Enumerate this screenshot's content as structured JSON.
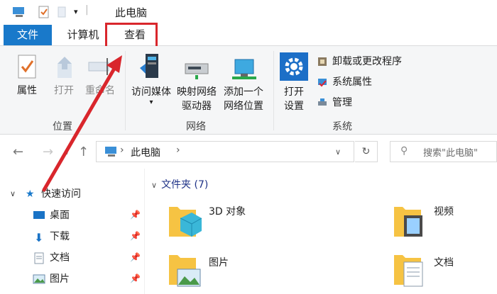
{
  "title": "此电脑",
  "tabs": {
    "file": "文件",
    "computer": "计算机",
    "view": "查看"
  },
  "ribbon": {
    "location": {
      "label": "位置",
      "buttons": [
        {
          "label": "属性",
          "icon": "properties-check-icon"
        },
        {
          "label": "打开",
          "icon": "open-arrow-icon"
        },
        {
          "label": "重命名",
          "icon": "rename-icon"
        }
      ]
    },
    "network": {
      "label": "网络",
      "buttons": [
        {
          "line1": "访问媒体",
          "line2": "",
          "icon": "media-server-icon"
        },
        {
          "line1": "映射网络",
          "line2": "驱动器",
          "icon": "map-drive-icon"
        },
        {
          "line1": "添加一个",
          "line2": "网络位置",
          "icon": "network-location-icon"
        }
      ]
    },
    "system": {
      "label": "系统",
      "open_settings_line1": "打开",
      "open_settings_line2": "设置",
      "items": [
        {
          "label": "卸载或更改程序",
          "icon": "uninstall-icon"
        },
        {
          "label": "系统属性",
          "icon": "system-properties-icon"
        },
        {
          "label": "管理",
          "icon": "manage-icon"
        }
      ]
    }
  },
  "address": {
    "path": "此电脑"
  },
  "search": {
    "placeholder": "搜索\"此电脑\""
  },
  "nav": {
    "quick_access": "快速访问",
    "items": [
      {
        "label": "桌面",
        "icon": "desktop-folder-icon"
      },
      {
        "label": "下载",
        "icon": "download-folder-icon"
      },
      {
        "label": "文档",
        "icon": "documents-folder-icon"
      },
      {
        "label": "图片",
        "icon": "pictures-folder-icon"
      }
    ]
  },
  "folders": {
    "header": "文件夹 (7)",
    "items": [
      {
        "label": "3D 对象",
        "icon": "3d-objects-folder-icon"
      },
      {
        "label": "视频",
        "icon": "videos-folder-icon"
      },
      {
        "label": "图片",
        "icon": "pictures-folder-icon"
      },
      {
        "label": "文档",
        "icon": "documents-folder-icon"
      }
    ]
  },
  "colors": {
    "accent": "#1979ca",
    "highlight": "#d9262c",
    "folder": "#f6c343"
  }
}
